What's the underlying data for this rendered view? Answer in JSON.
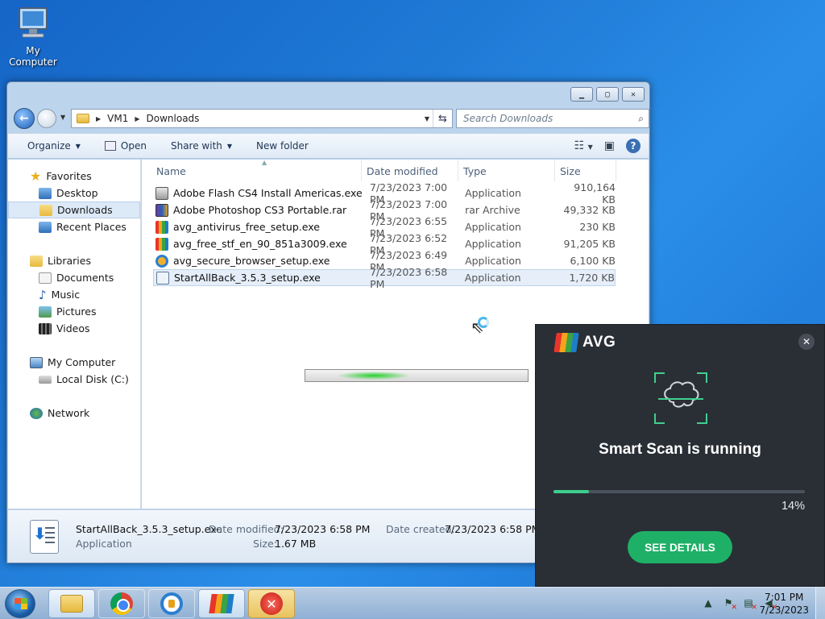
{
  "desktop": {
    "icon_label": "My Computer"
  },
  "window": {
    "breadcrumb": [
      "VM1",
      "Downloads"
    ],
    "search_placeholder": "Search Downloads",
    "toolbar": {
      "organize": "Organize",
      "open": "Open",
      "share_with": "Share with",
      "new_folder": "New folder"
    },
    "nav": {
      "favorites": "Favorites",
      "desktop": "Desktop",
      "downloads": "Downloads",
      "recent_places": "Recent Places",
      "libraries": "Libraries",
      "documents": "Documents",
      "music": "Music",
      "pictures": "Pictures",
      "videos": "Videos",
      "my_computer": "My Computer",
      "local_disk": "Local Disk (C:)",
      "network": "Network"
    },
    "columns": {
      "name": "Name",
      "date_modified": "Date modified",
      "type": "Type",
      "size": "Size"
    },
    "files": [
      {
        "name": "Adobe Flash CS4 Install Americas.exe",
        "date": "7/23/2023 7:00 PM",
        "type": "Application",
        "size": "910,164 KB",
        "icon": "flash-installer-icon"
      },
      {
        "name": "Adobe Photoshop CS3 Portable.rar",
        "date": "7/23/2023 7:00 PM",
        "type": "rar Archive",
        "size": "49,332 KB",
        "icon": "rar-archive-icon"
      },
      {
        "name": "avg_antivirus_free_setup.exe",
        "date": "7/23/2023 6:55 PM",
        "type": "Application",
        "size": "230 KB",
        "icon": "avg-setup-icon"
      },
      {
        "name": "avg_free_stf_en_90_851a3009.exe",
        "date": "7/23/2023 6:52 PM",
        "type": "Application",
        "size": "91,205 KB",
        "icon": "avg-setup-icon"
      },
      {
        "name": "avg_secure_browser_setup.exe",
        "date": "7/23/2023 6:49 PM",
        "type": "Application",
        "size": "6,100 KB",
        "icon": "avg-browser-icon"
      },
      {
        "name": "StartAllBack_3.5.3_setup.exe",
        "date": "7/23/2023 6:58 PM",
        "type": "Application",
        "size": "1,720 KB",
        "icon": "setup-icon"
      }
    ],
    "details": {
      "file_name": "StartAllBack_3.5.3_setup.exe",
      "file_type": "Application",
      "date_modified_label": "Date modified:",
      "date_modified": "7/23/2023 6:58 PM",
      "size_label": "Size:",
      "size": "1.67 MB",
      "date_created_label": "Date created:",
      "date_created": "7/23/2023 6:58 PM"
    }
  },
  "avg": {
    "brand": "AVG",
    "title": "Smart Scan is running",
    "progress": 0.14,
    "progress_label": "14%",
    "button": "SEE DETAILS",
    "accent": "#1fb067"
  },
  "taskbar": {
    "apps": [
      "windows-explorer",
      "chrome",
      "avg-secure-browser",
      "avg-antivirus",
      "error"
    ],
    "clock_time": "7:01 PM",
    "clock_date": "7/23/2023"
  }
}
